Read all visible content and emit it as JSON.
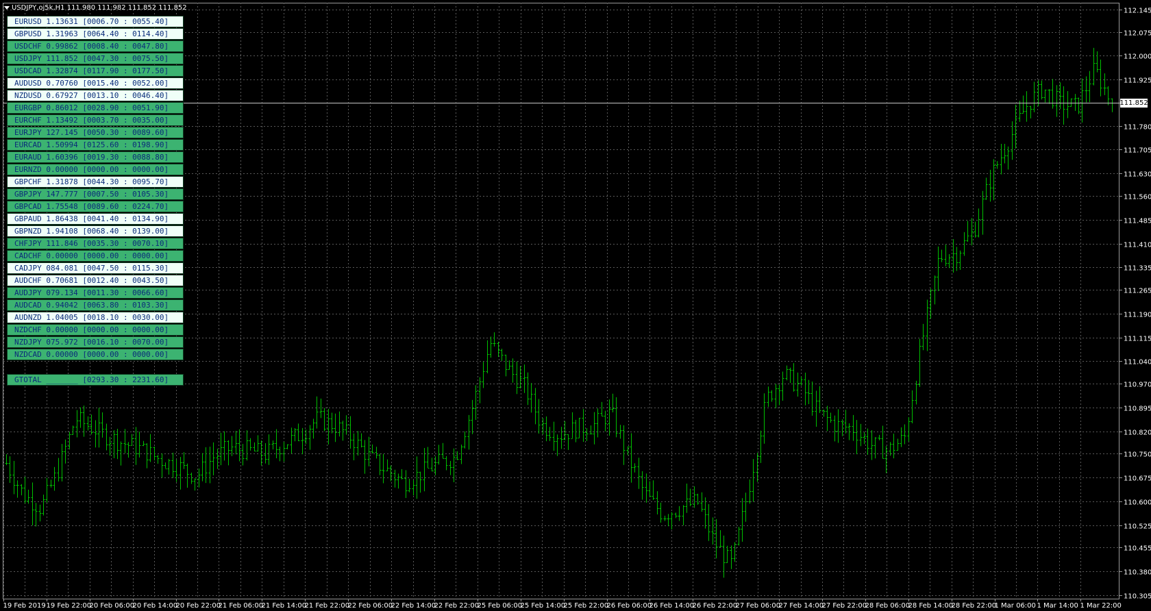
{
  "title": "USDJPY,oj5k,H1  111.980 111.982 111.852 111.852",
  "current_price": "111.852",
  "price_axis": [
    "112.145",
    "112.075",
    "112.000",
    "111.925",
    "111.852",
    "111.780",
    "111.705",
    "111.630",
    "111.560",
    "111.485",
    "111.410",
    "111.335",
    "111.265",
    "111.190",
    "111.115",
    "111.040",
    "110.970",
    "110.895",
    "110.820",
    "110.750",
    "110.675",
    "110.600",
    "110.525",
    "110.455",
    "110.380",
    "110.305"
  ],
  "time_axis": [
    "19 Feb 2019",
    "19 Feb 22:00",
    "20 Feb 06:00",
    "20 Feb 14:00",
    "20 Feb 22:00",
    "21 Feb 06:00",
    "21 Feb 14:00",
    "21 Feb 22:00",
    "22 Feb 06:00",
    "22 Feb 14:00",
    "22 Feb 22:00",
    "25 Feb 06:00",
    "25 Feb 14:00",
    "25 Feb 22:00",
    "26 Feb 06:00",
    "26 Feb 14:00",
    "26 Feb 22:00",
    "27 Feb 06:00",
    "27 Feb 14:00",
    "27 Feb 22:00",
    "28 Feb 06:00",
    "28 Feb 14:00",
    "28 Feb 22:00",
    "1 Mar 06:00",
    "1 Mar 14:00",
    "1 Mar 22:00"
  ],
  "pairs": [
    {
      "text": "EURUSD 1.13631 [0006.70 : 0055.40]",
      "state": "dn"
    },
    {
      "text": "GBPUSD 1.31963 [0064.40 : 0114.40]",
      "state": "dn"
    },
    {
      "text": "USDCHF 0.99862 [0008.40 : 0047.80]",
      "state": "up"
    },
    {
      "text": "USDJPY 111.852 [0047.30 : 0075.50]",
      "state": "up"
    },
    {
      "text": "USDCAD 1.32874 [0117.90 : 0177.50]",
      "state": "up"
    },
    {
      "text": "AUDUSD 0.70760 [0015.40 : 0052.00]",
      "state": "dn"
    },
    {
      "text": "NZDUSD 0.67927 [0013.10 : 0046.40]",
      "state": "dn"
    },
    {
      "text": "EURGBP 0.86012 [0028.90 : 0051.90]",
      "state": "up"
    },
    {
      "text": "EURCHF 1.13492 [0003.70 : 0035.00]",
      "state": "up"
    },
    {
      "text": "EURJPY 127.145 [0050.30 : 0089.60]",
      "state": "up"
    },
    {
      "text": "EURCAD 1.50994 [0125.60 : 0198.90]",
      "state": "up"
    },
    {
      "text": "EURAUD 1.60396 [0019.30 : 0088.80]",
      "state": "up"
    },
    {
      "text": "EURNZD 0.00000 [0000.00 : 0000.00]",
      "state": "up"
    },
    {
      "text": "GBPCHF 1.31878 [0044.30 : 0095.70]",
      "state": "dn"
    },
    {
      "text": "GBPJPY 147.777 [0007.50 : 0105.30]",
      "state": "up"
    },
    {
      "text": "GBPCAD 1.75548 [0089.60 : 0224.70]",
      "state": "up"
    },
    {
      "text": "GBPAUD 1.86438 [0041.40 : 0134.90]",
      "state": "dn"
    },
    {
      "text": "GBPNZD 1.94108 [0068.40 : 0139.00]",
      "state": "dn"
    },
    {
      "text": "CHFJPY 111.846 [0035.30 : 0070.10]",
      "state": "up"
    },
    {
      "text": "CADCHF 0.00000 [0000.00 : 0000.00]",
      "state": "up"
    },
    {
      "text": "CADJPY 084.081 [0047.50 : 0115.30]",
      "state": "dn"
    },
    {
      "text": "AUDCHF 0.70681 [0012.40 : 0043.50]",
      "state": "dn"
    },
    {
      "text": "AUDJPY 079.134 [0011.30 : 0066.60]",
      "state": "up"
    },
    {
      "text": "AUDCAD 0.94042 [0063.80 : 0103.30]",
      "state": "up"
    },
    {
      "text": "AUDNZD 1.04005 [0018.10 : 0030.00]",
      "state": "dn"
    },
    {
      "text": "NZDCHF 0.00000 [0000.00 : 0000.00]",
      "state": "up"
    },
    {
      "text": "NZDJPY 075.972 [0016.10 : 0070.00]",
      "state": "up"
    },
    {
      "text": "NZDCAD 0.00000 [0000.00 : 0000.00]",
      "state": "up"
    }
  ],
  "total": "GTOTAL _______ [0293.30 : 2231.60]",
  "colors": {
    "bar": "#00c000",
    "grid": "#5a5a5a",
    "axis_text": "#ffffff",
    "panel_up": "#3cb371",
    "panel_dn": "#f0fff8"
  },
  "chart_data": {
    "type": "ohlc",
    "symbol": "USDJPY",
    "timeframe": "H1",
    "ylim": [
      110.305,
      112.145
    ],
    "grid": true,
    "series_close_path": [
      110.72,
      110.62,
      110.58,
      110.7,
      110.86,
      110.83,
      110.8,
      110.78,
      110.76,
      110.73,
      110.71,
      110.68,
      110.74,
      110.77,
      110.76,
      110.75,
      110.78,
      110.81,
      110.86,
      110.84,
      110.8,
      110.74,
      110.7,
      110.66,
      110.69,
      110.72,
      110.74,
      110.9,
      111.1,
      111.02,
      110.96,
      110.84,
      110.81,
      110.83,
      110.84,
      110.88,
      110.74,
      110.62,
      110.56,
      110.58,
      110.6,
      110.47,
      110.4,
      110.65,
      110.92,
      111.0,
      110.96,
      110.88,
      110.84,
      110.83,
      110.78,
      110.76,
      110.8,
      111.1,
      111.37,
      111.38,
      111.45,
      111.62,
      111.73,
      111.84,
      111.9,
      111.85,
      111.84,
      111.96,
      111.85
    ]
  }
}
